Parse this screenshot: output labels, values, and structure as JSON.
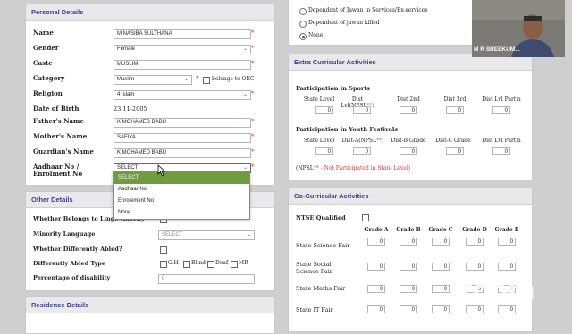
{
  "personal": {
    "title": "Personal Details",
    "name_label": "Name",
    "name_value": "M NASIBA SULTHANA",
    "gender_label": "Gender",
    "gender_value": "Female",
    "caste_label": "Caste",
    "caste_value": "MUSLIM",
    "category_label": "Category",
    "category_value": "Muslim",
    "oec_label": "belongs to OEC",
    "religion_label": "Religion",
    "religion_value": "4 Islam",
    "dob_label": "Date of Birth",
    "dob_value": "23-11-2005",
    "father_label": "Father's Name",
    "father_value": "K MOHAMED BABU",
    "mother_label": "Mother's Name",
    "mother_value": "SAFIYA",
    "guardian_label": "Guardian's Name",
    "guardian_value": "K MOHAMED BABU",
    "aadhaar_label": "Aadhaar No / Enrolment No",
    "aadhaar_value": "SELECT",
    "required_mark": "*"
  },
  "aadhaar_dropdown": {
    "options": [
      "SELECT",
      "Aadhaar No",
      "Enrolement No",
      "None"
    ],
    "selected": "SELECT"
  },
  "other": {
    "title": "Other Details",
    "ling_label": "Whether Belongs to Ling.Minority",
    "minority_lang_label": "Minority Language",
    "minority_lang_value": "SELECT",
    "diff_abled_label": "Whether Differently Abled?",
    "diff_type_label": "Differently Abled Type",
    "diff_types": [
      "O.H",
      "Blind",
      "Deaf",
      "MR"
    ],
    "disability_pct_label": "Percentage of disability",
    "disability_pct_value": "0"
  },
  "residence": {
    "title": "Residence Details"
  },
  "dependent": {
    "options": [
      "Dependent of Jawan in Services/Ex-services",
      "Dependent of jawan killed",
      "None"
    ],
    "selected": "None"
  },
  "extra": {
    "title": "Extra Curricular Activities",
    "sports_title": "Participation in Sports",
    "sports_cols": [
      "State Level",
      "Dist Lvl(NPSL",
      "**)",
      "Dist 2nd",
      "Dist 3rd",
      "Dist Lvl Part'n"
    ],
    "sports_vals": [
      "0",
      "0",
      "0",
      "0",
      "0"
    ],
    "youth_title": "Participation in Youth Festivals",
    "youth_cols": [
      "State Level",
      "Dist-A(NPSL",
      "**)",
      "Dist-B Grade",
      "Dist-C Grade",
      "Dist Lvl Part'n"
    ],
    "youth_vals": [
      "0",
      "0",
      "0",
      "0",
      "0"
    ],
    "note_a": "(NPSL",
    "note_b": "** - Not Participated in State Level)"
  },
  "co": {
    "title": "Co-Curricular Activities",
    "ntse_label": "NTSE Qualified",
    "grade_cols": [
      "Grade A",
      "Grade B",
      "Grade C",
      "Grade D",
      "Grade E"
    ],
    "rows": [
      {
        "label": "State Science Fair",
        "vals": [
          "0",
          "0",
          "0",
          "0",
          "0"
        ]
      },
      {
        "label": "State Social Science Fair",
        "vals": [
          "0",
          "0",
          "0",
          "0",
          "0"
        ]
      },
      {
        "label": "State Maths Fair",
        "vals": [
          "0",
          "0",
          "0",
          "0",
          "0"
        ]
      },
      {
        "label": "State IT Fair",
        "vals": [
          "0",
          "0",
          "0",
          "0",
          "0"
        ]
      }
    ]
  },
  "meeting": {
    "participant_name": "M R SREEKUM...",
    "logo": "zoom"
  }
}
